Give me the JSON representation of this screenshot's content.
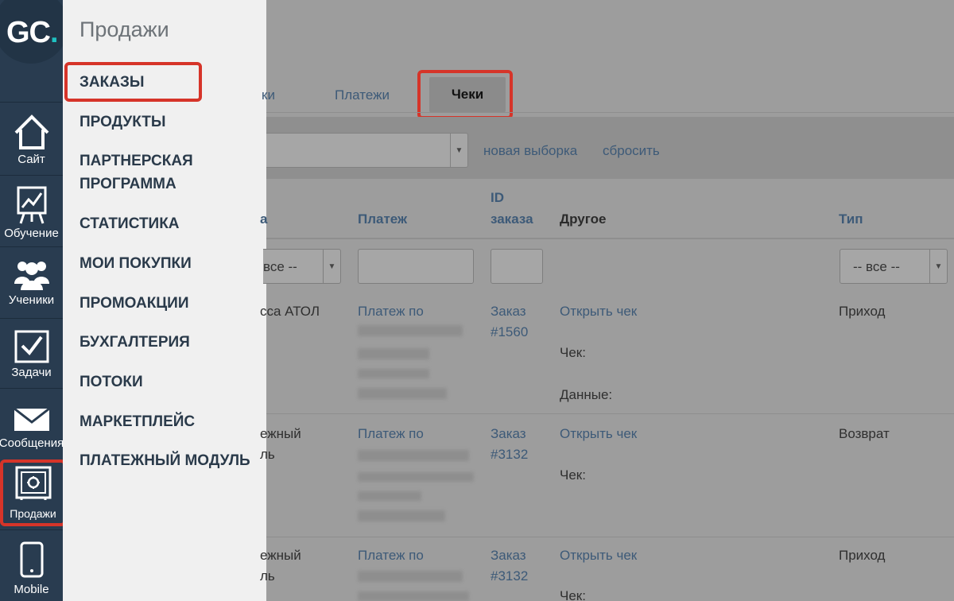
{
  "brand": {
    "logo_main": "GC",
    "logo_dot": "."
  },
  "rail": {
    "items": [
      {
        "label": "Сайт",
        "icon": "house-icon"
      },
      {
        "label": "Обучение",
        "icon": "training-chart-icon"
      },
      {
        "label": "Ученики",
        "icon": "students-icon"
      },
      {
        "label": "Задачи",
        "icon": "checkbox-icon"
      },
      {
        "label": "Сообщения",
        "icon": "envelope-icon"
      },
      {
        "label": "Продажи",
        "icon": "safe-icon"
      },
      {
        "label": "Mobile",
        "icon": "phone-icon"
      }
    ]
  },
  "menu": {
    "title": "Продажи",
    "items": [
      {
        "label": "ЗАКАЗЫ"
      },
      {
        "label": "ПРОДУКТЫ"
      },
      {
        "label": "ПАРТНЕРСКАЯ ПРОГРАММА"
      },
      {
        "label": "СТАТИСТИКА"
      },
      {
        "label": "МОИ ПОКУПКИ"
      },
      {
        "label": "ПРОМОАКЦИИ"
      },
      {
        "label": "БУХГАЛТЕРИЯ"
      },
      {
        "label": "ПОТОКИ"
      },
      {
        "label": "МАРКЕТПЛЕЙС"
      },
      {
        "label": "ПЛАТЕЖНЫЙ МОДУЛЬ"
      }
    ]
  },
  "tabs": {
    "partial": "ки",
    "payments": "Платежи",
    "checks": "Чеки"
  },
  "filter_bar": {
    "new_selection": "новая выборка",
    "reset": "сбросить"
  },
  "table": {
    "headers": {
      "col1_partial": "а",
      "payment": "Платеж",
      "order_id_line1": "ID",
      "order_id_line2": "заказа",
      "other": "Другое",
      "type": "Тип"
    },
    "filters": {
      "col1_select": "все --",
      "type_select": "-- все --"
    },
    "rows": [
      {
        "col1_line1": "сса АТОЛ",
        "col1_line2": "",
        "payment": "Платеж по",
        "order_line1": "Заказ",
        "order_line2": "#1560",
        "open_check": "Открыть чек",
        "check_label": "Чек:",
        "data_label": "Данные:",
        "type": "Приход"
      },
      {
        "col1_line1": "ежный",
        "col1_line2": "ль",
        "payment": "Платеж по",
        "order_line1": "Заказ",
        "order_line2": "#3132",
        "open_check": "Открыть чек",
        "check_label": "Чек:",
        "data_label": "",
        "type": "Возврат"
      },
      {
        "col1_line1": "ежный",
        "col1_line2": "ль",
        "payment": "Платеж по",
        "order_line1": "Заказ",
        "order_line2": "#3132",
        "open_check": "Открыть чек",
        "check_label": "Чек:",
        "data_label": "",
        "type": "Приход"
      }
    ]
  },
  "colors": {
    "rail_bg": "#293c50",
    "menu_bg": "#f0f0f0",
    "overlay_bg": "#9d9d9d",
    "highlight": "#d63429",
    "link": "#3d5a78",
    "logo_accent": "#1fc1c1"
  }
}
